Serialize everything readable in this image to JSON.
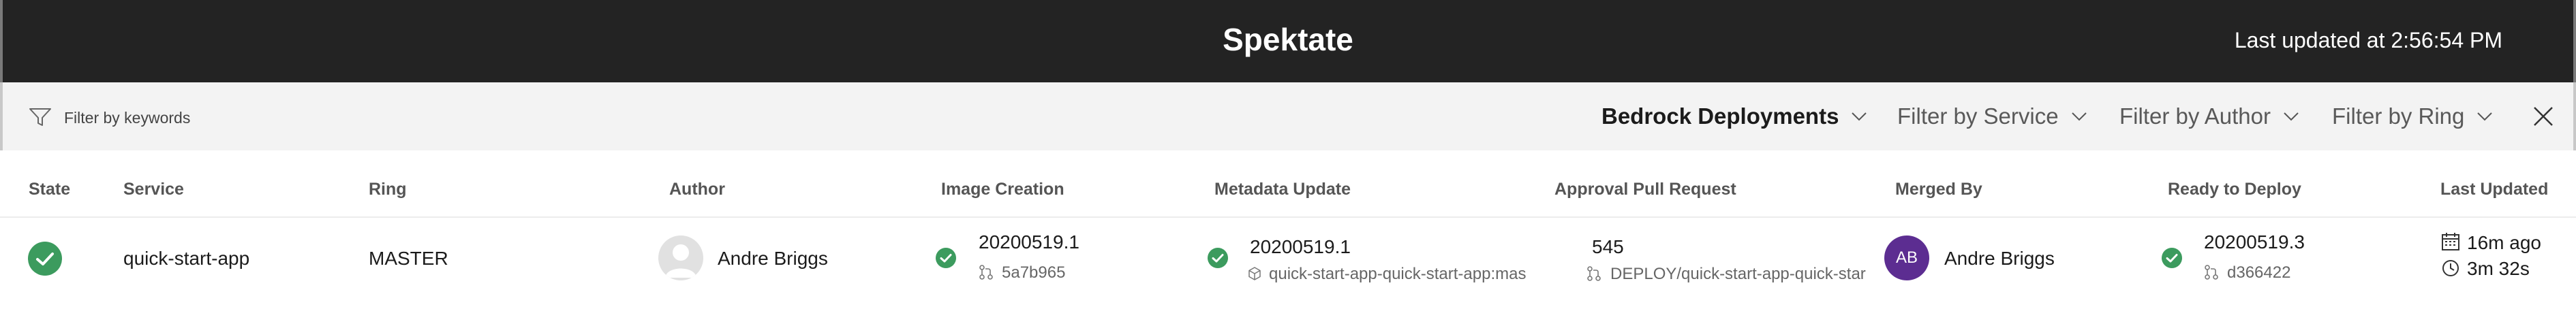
{
  "header": {
    "title": "Spektate",
    "last_updated": "Last updated at 2:56:54 PM"
  },
  "filterbar": {
    "search_placeholder": "Filter by keywords",
    "deployments_label": "Bedrock Deployments",
    "service_filter": "Filter by Service",
    "author_filter": "Filter by Author",
    "ring_filter": "Filter by Ring"
  },
  "columns": {
    "state": "State",
    "service": "Service",
    "ring": "Ring",
    "author": "Author",
    "image_creation": "Image Creation",
    "metadata_update": "Metadata Update",
    "approval_pr": "Approval Pull Request",
    "merged_by": "Merged By",
    "ready_to_deploy": "Ready to Deploy",
    "last_updated": "Last Updated"
  },
  "rows": [
    {
      "state": "succeeded",
      "service": "quick-start-app",
      "ring": "MASTER",
      "author": "Andre Briggs",
      "image_creation": {
        "build": "20200519.1",
        "commit": "5a7b965",
        "status": "succeeded"
      },
      "metadata_update": {
        "build": "20200519.1",
        "image": "quick-start-app-quick-start-app:mas",
        "status": "succeeded"
      },
      "approval_pr": {
        "number": "545",
        "branch": "DEPLOY/quick-start-app-quick-star"
      },
      "merged_by": {
        "initials": "AB",
        "name": "Andre Briggs"
      },
      "ready_to_deploy": {
        "build": "20200519.3",
        "commit": "d366422",
        "status": "succeeded"
      },
      "last_updated": {
        "relative": "16m ago",
        "duration": "3m 32s"
      }
    }
  ],
  "colors": {
    "header_bg": "#232323",
    "filterbar_bg": "#f3f3f3",
    "success": "#3c9b5e",
    "avatar_purple": "#5c2d91"
  },
  "icons": [
    "filter-icon",
    "chevron-down-icon",
    "close-icon",
    "check-circle-icon",
    "commit-icon",
    "package-icon",
    "pull-request-icon",
    "calendar-icon",
    "clock-icon",
    "default-avatar-icon"
  ]
}
